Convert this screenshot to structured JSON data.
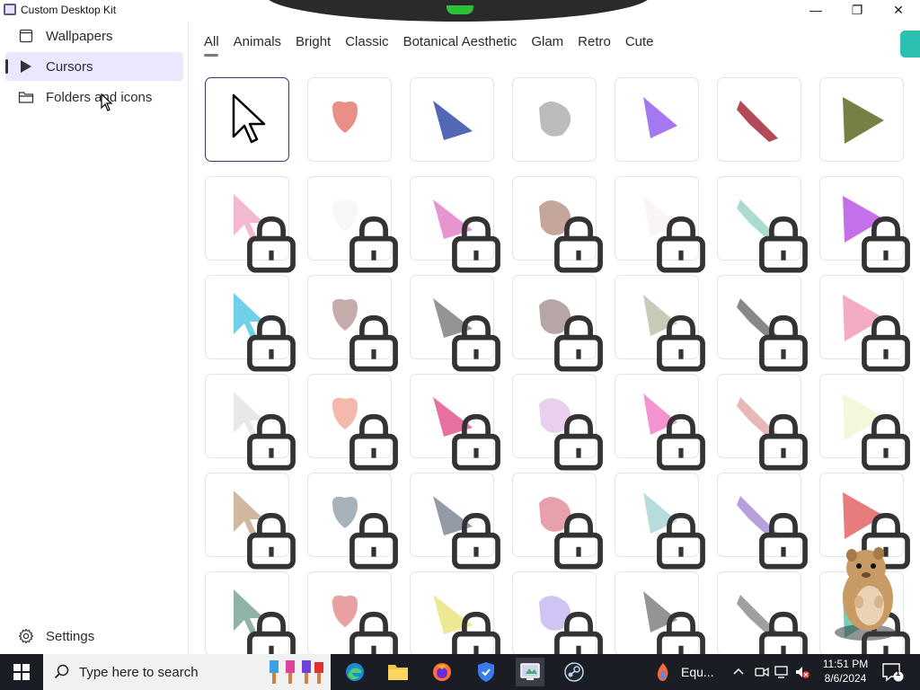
{
  "window": {
    "title": "Custom Desktop Kit",
    "minimize": "—",
    "maximize": "❐",
    "close": "✕"
  },
  "sidebar": {
    "items": [
      {
        "label": "Wallpapers",
        "icon": "wallpaper-icon"
      },
      {
        "label": "Cursors",
        "icon": "cursor-icon",
        "active": true
      },
      {
        "label": "Folders and icons",
        "icon": "folder-icon"
      }
    ],
    "settings_label": "Settings"
  },
  "tabs": [
    {
      "label": "All",
      "active": true
    },
    {
      "label": "Animals"
    },
    {
      "label": "Bright"
    },
    {
      "label": "Classic"
    },
    {
      "label": "Botanical Aesthetic"
    },
    {
      "label": "Glam"
    },
    {
      "label": "Retro"
    },
    {
      "label": "Cute"
    }
  ],
  "accent_color": "#2cc0b2",
  "cursor_tiles": [
    {
      "name": "classic-arrow-cursor",
      "locked": false,
      "color": "#000000",
      "selected": true
    },
    {
      "name": "pink-heart-paw-cursor",
      "locked": false,
      "color": "#e88a80"
    },
    {
      "name": "blue-gradient-cursor",
      "locked": false,
      "color": "#4a60b0"
    },
    {
      "name": "gray-smoke-cursor",
      "locked": false,
      "color": "#b8b8b8"
    },
    {
      "name": "purple-gradient-cursor",
      "locked": false,
      "color": "#a070f0"
    },
    {
      "name": "lipstick-cursor",
      "locked": false,
      "color": "#b04050"
    },
    {
      "name": "olive-triangle-cursor",
      "locked": false,
      "color": "#6e7a3a"
    },
    {
      "name": "pink-glitter-cursor",
      "locked": true,
      "color": "#f0a0c0"
    },
    {
      "name": "white-flower-cursor",
      "locked": true,
      "color": "#f4f4f4"
    },
    {
      "name": "pink-lace-cursor",
      "locked": true,
      "color": "#e070c0"
    },
    {
      "name": "cat-tail-cursor",
      "locked": true,
      "color": "#b08878"
    },
    {
      "name": "white-floral-cursor",
      "locked": true,
      "color": "#f8f0f0"
    },
    {
      "name": "mint-cursor",
      "locked": true,
      "color": "#90d0c0"
    },
    {
      "name": "violet-glow-cursor",
      "locked": true,
      "color": "#b040e0"
    },
    {
      "name": "cyan-sparkle-cursor",
      "locked": true,
      "color": "#40c0e0"
    },
    {
      "name": "taupe-arrow-cursor",
      "locked": true,
      "color": "#b09090"
    },
    {
      "name": "paperclip-cursor",
      "locked": true,
      "color": "#707070"
    },
    {
      "name": "taupe-shadow-cursor",
      "locked": true,
      "color": "#a08888"
    },
    {
      "name": "sage-floral-cursor",
      "locked": true,
      "color": "#b8b8a0"
    },
    {
      "name": "charcoal-arrow-cursor",
      "locked": true,
      "color": "#606060"
    },
    {
      "name": "pink-soft-cursor",
      "locked": true,
      "color": "#f090b0"
    },
    {
      "name": "white-bear-cursor",
      "locked": true,
      "color": "#e0e0e0"
    },
    {
      "name": "peach-cursor",
      "locked": true,
      "color": "#f0a090"
    },
    {
      "name": "magenta-glass-cursor",
      "locked": true,
      "color": "#e04080"
    },
    {
      "name": "lavender-cursor",
      "locked": true,
      "color": "#e0c0e8"
    },
    {
      "name": "pink-nail-cursor",
      "locked": true,
      "color": "#f070c0"
    },
    {
      "name": "outlined-pink-cursor",
      "locked": true,
      "color": "#e0a0a0"
    },
    {
      "name": "leaf-cursor",
      "locked": true,
      "color": "#f0f4d0"
    },
    {
      "name": "wheat-branch-cursor",
      "locked": true,
      "color": "#c0a080"
    },
    {
      "name": "watering-can-cursor",
      "locked": true,
      "color": "#8a9aa0"
    },
    {
      "name": "slate-arrow-cursor",
      "locked": true,
      "color": "#707888"
    },
    {
      "name": "pink-outlined-arrow-cursor",
      "locked": true,
      "color": "#e08090"
    },
    {
      "name": "cloud-cursor",
      "locked": true,
      "color": "#a0d0d0"
    },
    {
      "name": "lilac-arrow-cursor",
      "locked": true,
      "color": "#a080d0"
    },
    {
      "name": "red-star-cursor",
      "locked": true,
      "color": "#e05050"
    },
    {
      "name": "green-leaf-cursor",
      "locked": true,
      "color": "#6a9a88"
    },
    {
      "name": "rose-heart-cursor",
      "locked": true,
      "color": "#e08080"
    },
    {
      "name": "yellow-arrow-cursor",
      "locked": true,
      "color": "#e8e070"
    },
    {
      "name": "lilac-cloud-cursor",
      "locked": true,
      "color": "#c0b0f0"
    },
    {
      "name": "sketch-arrow-cursor",
      "locked": true,
      "color": "#707070"
    },
    {
      "name": "hand-pointer-cursor",
      "locked": true,
      "color": "#808080"
    },
    {
      "name": "green-sparkle-cursor",
      "locked": true,
      "color": "#40c0a0"
    }
  ],
  "taskbar": {
    "search_placeholder": "Type here to search",
    "running_app_label": "Equ...",
    "time": "11:51 PM",
    "date": "8/6/2024",
    "notification_count": "1"
  }
}
